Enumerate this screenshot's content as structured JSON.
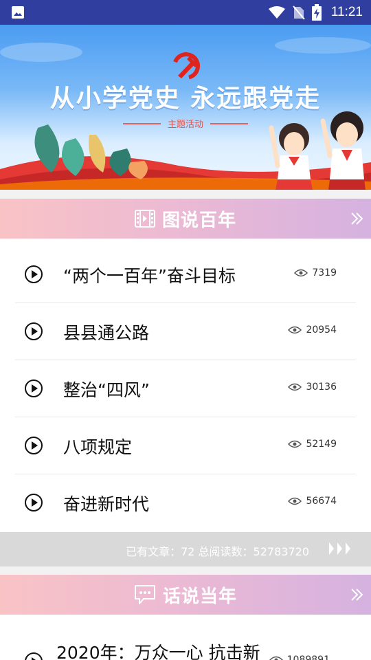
{
  "status_bar": {
    "time": "11:21",
    "icons": [
      "gallery-icon",
      "wifi-icon",
      "no-sim-icon",
      "battery-charging-icon"
    ]
  },
  "banner": {
    "title": "从小学党史  永远跟党走",
    "subtitle": "主题活动"
  },
  "section1": {
    "title": "图说百年",
    "icon": "film-icon",
    "more_icon": "double-chevron-right-icon",
    "items": [
      {
        "title": "“两个一百年”奋斗目标",
        "views": "7319"
      },
      {
        "title": "县县通公路",
        "views": "20954"
      },
      {
        "title": "整治“四风”",
        "views": "30136"
      },
      {
        "title": "八项规定",
        "views": "52149"
      },
      {
        "title": "奋进新时代",
        "views": "56674"
      }
    ],
    "stats": "已有文章：72   总阅读数：52783720"
  },
  "section2": {
    "title": "话说当年",
    "icon": "chat-bubble-icon",
    "more_icon": "double-chevron-right-icon",
    "items": [
      {
        "title": "2020年：万众一心 抗击新",
        "views": "1089891"
      }
    ]
  },
  "colors": {
    "status_bar": "#303f9f",
    "header_gradient_start": "#f9c3c5",
    "header_gradient_end": "#d5b2e0",
    "stats_bar": "#d9d9d9"
  }
}
